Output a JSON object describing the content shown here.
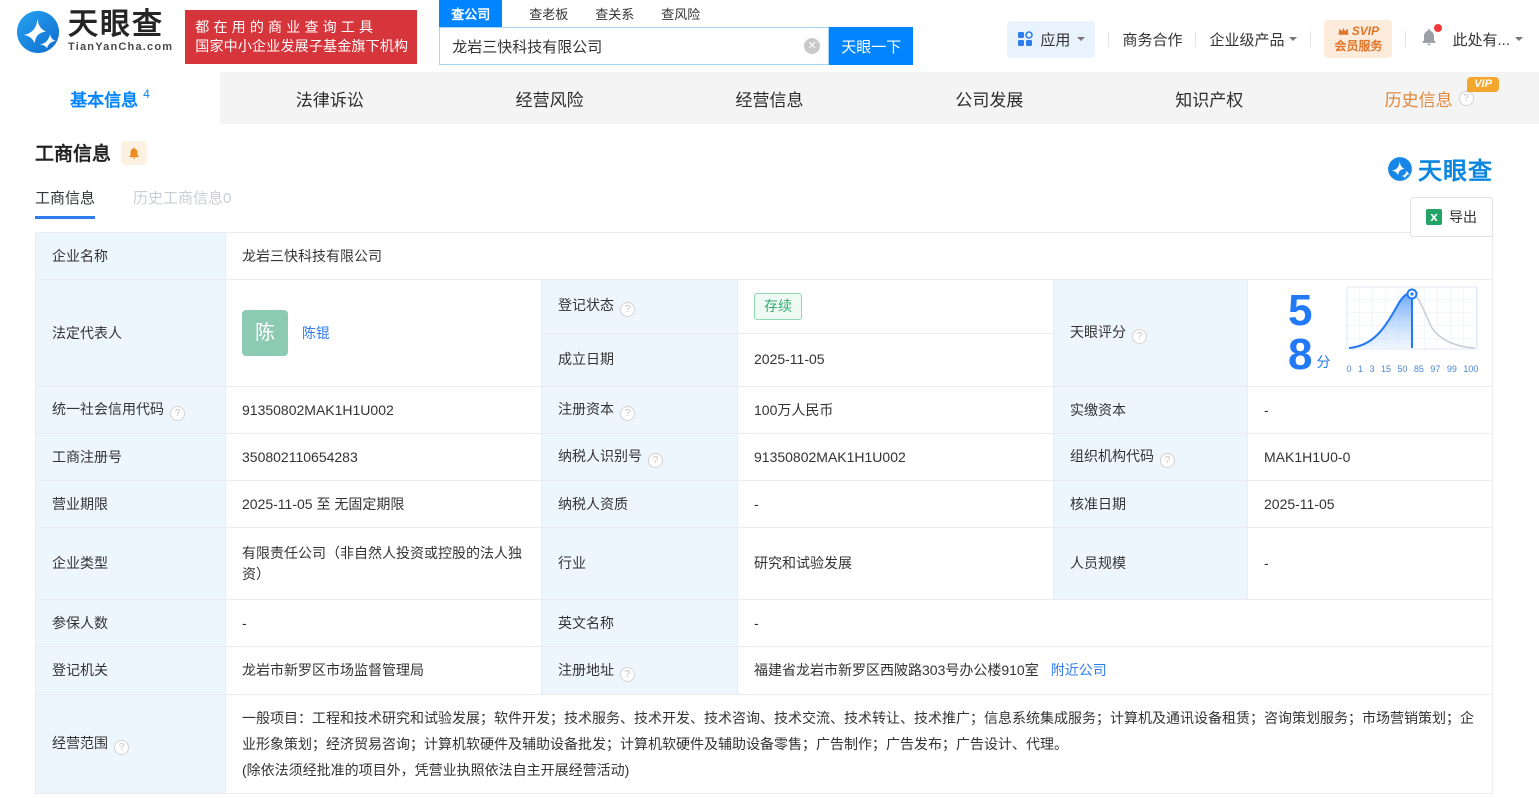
{
  "colors": {
    "brand": "#0084ff",
    "link": "#2e7cee",
    "score": "#2279f7",
    "red": "#d6363b",
    "orange": "#e0883c",
    "vip": "#f5a62c",
    "green-t": "#36ab6f",
    "green-bg": "#effaf4",
    "green-bd": "#8fd8b2",
    "avatar": "#8ccab2",
    "lblbg": "#eef6fd",
    "bd": "#e9edf2",
    "tabbar": "#f4f4f4"
  },
  "header": {
    "logo": {
      "name": "天眼查",
      "domain": "TianYanCha.com"
    },
    "slogan": {
      "line1": "都在用的商业查询工具",
      "line2": "国家中小企业发展子基金旗下机构"
    },
    "search_tabs": [
      {
        "label": "查公司"
      },
      {
        "label": "查老板"
      },
      {
        "label": "查关系"
      },
      {
        "label": "查风险"
      }
    ],
    "search": {
      "value": "龙岩三快科技有限公司",
      "button": "天眼一下"
    },
    "nav": {
      "apps": "应用",
      "cooperation": "商务合作",
      "enterprise": "企业级产品",
      "svip_line1": "SVIP",
      "svip_line2": "会员服务",
      "more": "此处有..."
    }
  },
  "tabs": [
    {
      "label": "基本信息",
      "count": "4"
    },
    {
      "label": "法律诉讼"
    },
    {
      "label": "经营风险"
    },
    {
      "label": "经营信息"
    },
    {
      "label": "公司发展"
    },
    {
      "label": "知识产权"
    },
    {
      "label": "历史信息",
      "vip": "VIP"
    }
  ],
  "section": {
    "title": "工商信息",
    "watermark": "天眼查",
    "subtabs": [
      {
        "label": "工商信息"
      },
      {
        "label": "历史工商信息0"
      }
    ],
    "export_label": "导出"
  },
  "table": {
    "company": {
      "label": "企业名称",
      "value": "龙岩三快科技有限公司"
    },
    "legal": {
      "label": "法定代表人",
      "avatar": "陈",
      "name": "陈锟"
    },
    "status": {
      "label": "登记状态",
      "value": "存续"
    },
    "established": {
      "label": "成立日期",
      "value": "2025-11-05"
    },
    "score": {
      "label": "天眼评分",
      "value": "58",
      "unit": "分",
      "axis": [
        "0",
        "1",
        "3",
        "15",
        "50",
        "85",
        "97",
        "99",
        "100"
      ]
    },
    "credit_code": {
      "label": "统一社会信用代码",
      "value": "91350802MAK1H1U002"
    },
    "reg_capital": {
      "label": "注册资本",
      "value": "100万人民币"
    },
    "paid_capital": {
      "label": "实缴资本",
      "value": "-"
    },
    "reg_number": {
      "label": "工商注册号",
      "value": "350802110654283"
    },
    "taxpayer_id": {
      "label": "纳税人识别号",
      "value": "91350802MAK1H1U002"
    },
    "org_code": {
      "label": "组织机构代码",
      "value": "MAK1H1U0-0"
    },
    "term": {
      "label": "营业期限",
      "value": "2025-11-05 至 无固定期限"
    },
    "taxpayer_quality": {
      "label": "纳税人资质",
      "value": "-"
    },
    "approval_date": {
      "label": "核准日期",
      "value": "2025-11-05"
    },
    "company_type": {
      "label": "企业类型",
      "value": "有限责任公司（非自然人投资或控股的法人独资）"
    },
    "industry": {
      "label": "行业",
      "value": "研究和试验发展"
    },
    "staff_size": {
      "label": "人员规模",
      "value": "-"
    },
    "insured": {
      "label": "参保人数",
      "value": "-"
    },
    "english_name": {
      "label": "英文名称",
      "value": "-"
    },
    "reg_authority": {
      "label": "登记机关",
      "value": "龙岩市新罗区市场监督管理局"
    },
    "reg_address": {
      "label": "注册地址",
      "value": "福建省龙岩市新罗区西陂路303号办公楼910室",
      "link": "附近公司"
    },
    "business_scope": {
      "label": "经营范围",
      "value": "一般项目：工程和技术研究和试验发展；软件开发；技术服务、技术开发、技术咨询、技术交流、技术转让、技术推广；信息系统集成服务；计算机及通讯设备租赁；咨询策划服务；市场营销策划；企业形象策划；经济贸易咨询；计算机软硬件及辅助设备批发；计算机软硬件及辅助设备零售；广告制作；广告发布；广告设计、代理。",
      "note": "(除依法须经批准的项目外，凭营业执照依法自主开展经营活动)"
    }
  }
}
